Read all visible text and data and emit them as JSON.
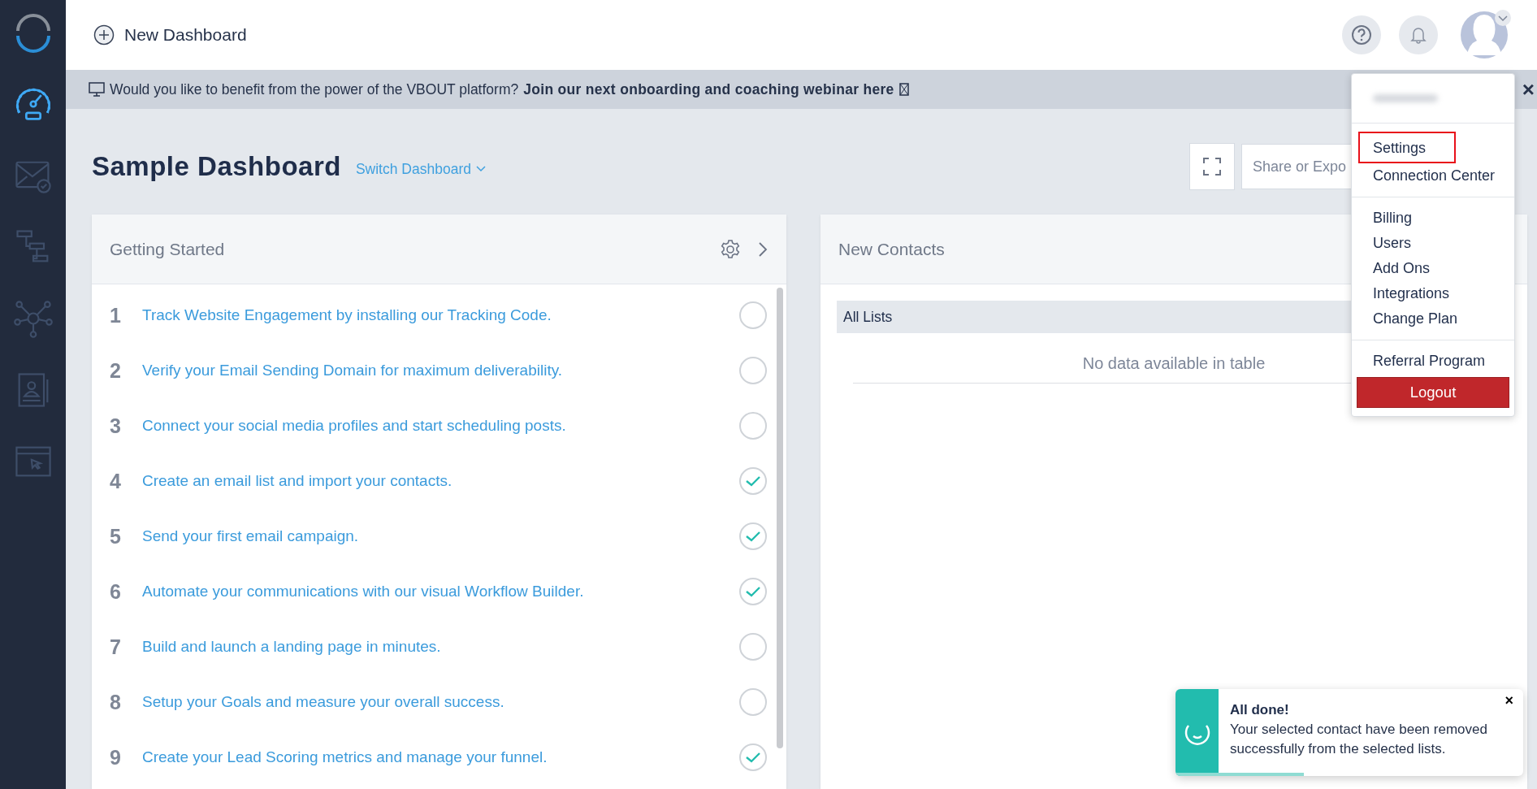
{
  "sidebar": {
    "items": [
      {
        "kind": "gauge",
        "selected": true
      },
      {
        "kind": "mail",
        "selected": false
      },
      {
        "kind": "flow",
        "selected": false
      },
      {
        "kind": "network",
        "selected": false
      },
      {
        "kind": "contact",
        "selected": false
      },
      {
        "kind": "browser",
        "selected": false
      }
    ]
  },
  "header": {
    "new_button": "New Dashboard"
  },
  "banner": {
    "text": "Would you like to benefit from the power of the VBOUT platform?",
    "link": "Join our next onboarding and coaching webinar here",
    "close": "×"
  },
  "page": {
    "title": "Sample Dashboard",
    "switch": "Switch Dashboard",
    "share": "Share or Expo"
  },
  "getting_started": {
    "title": "Getting Started",
    "items": [
      {
        "number": "1",
        "text": "Track Website Engagement by installing our Tracking Code.",
        "done": false
      },
      {
        "number": "2",
        "text": "Verify your Email Sending Domain for maximum deliverability.",
        "done": false
      },
      {
        "number": "3",
        "text": "Connect your social media profiles and start scheduling posts.",
        "done": false
      },
      {
        "number": "4",
        "text": "Create an email list and import your contacts.",
        "done": true
      },
      {
        "number": "5",
        "text": "Send your first email campaign.",
        "done": true
      },
      {
        "number": "6",
        "text": "Automate your communications with our visual Workflow Builder.",
        "done": true
      },
      {
        "number": "7",
        "text": "Build and launch a landing page in minutes.",
        "done": false
      },
      {
        "number": "8",
        "text": "Setup your Goals and measure your overall success.",
        "done": false
      },
      {
        "number": "9",
        "text": "Create your Lead Scoring metrics and manage your funnel.",
        "done": true
      }
    ]
  },
  "new_contacts": {
    "title": "New Contacts",
    "column": "All Lists",
    "empty": "No data available in table"
  },
  "user_menu": {
    "sections": [
      [
        {
          "label": "Settings",
          "highlighted": true
        },
        {
          "label": "Connection Center",
          "highlighted": false
        }
      ],
      [
        {
          "label": "Billing",
          "highlighted": false
        },
        {
          "label": "Users",
          "highlighted": false
        },
        {
          "label": "Add Ons",
          "highlighted": false
        },
        {
          "label": "Integrations",
          "highlighted": false
        },
        {
          "label": "Change Plan",
          "highlighted": false
        }
      ],
      [
        {
          "label": "Referral Program",
          "highlighted": false
        }
      ]
    ],
    "logout": "Logout"
  },
  "toast": {
    "title": "All done!",
    "message": "Your selected contact have been removed successfully from the selected lists.",
    "close": "×",
    "level": 0.37
  }
}
